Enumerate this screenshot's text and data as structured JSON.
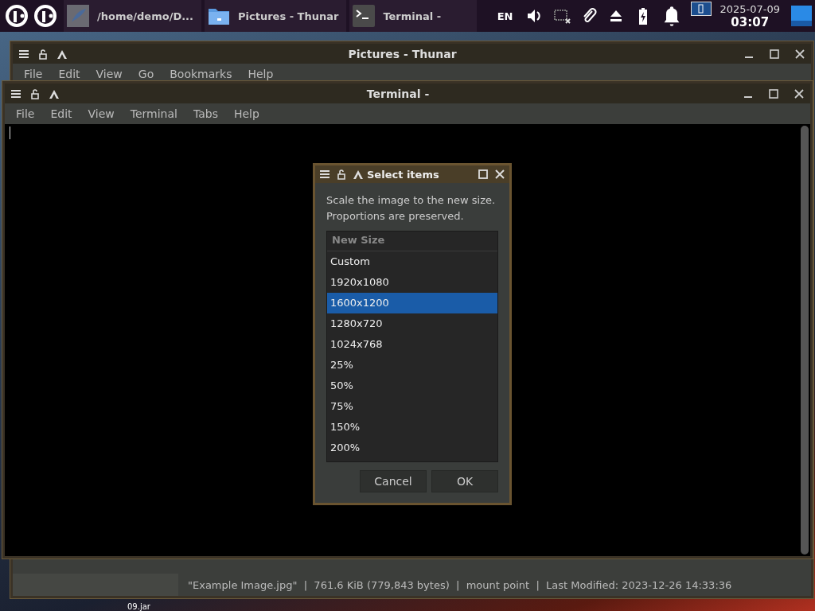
{
  "taskbar": {
    "tasks": [
      {
        "kind": "quill",
        "label": "/home/demo/D...",
        "selected": false
      },
      {
        "kind": "folder",
        "label": "Pictures - Thunar",
        "selected": false
      },
      {
        "kind": "terminal",
        "label": "Terminal -",
        "selected": false
      }
    ],
    "language": "EN",
    "date": "2025-07-09",
    "time": "03:07"
  },
  "desktop_label": "09.jar",
  "thunar": {
    "title": "Pictures - Thunar",
    "menu": [
      "File",
      "Edit",
      "View",
      "Go",
      "Bookmarks",
      "Help"
    ],
    "status": "\"Example Image.jpg\"  |  761.6 KiB (779,843 bytes)  |  mount point  |  Last Modified: 2023-12-26 14:33:36"
  },
  "terminal": {
    "title": "Terminal -",
    "menu": [
      "File",
      "Edit",
      "View",
      "Terminal",
      "Tabs",
      "Help"
    ]
  },
  "dialog": {
    "title": "Select items",
    "message": "Scale the image to the new size.\nProportions are preserved.",
    "column": "New Size",
    "items": [
      {
        "label": "Custom",
        "selected": false
      },
      {
        "label": "1920x1080",
        "selected": false
      },
      {
        "label": "1600x1200",
        "selected": true
      },
      {
        "label": "1280x720",
        "selected": false
      },
      {
        "label": "1024x768",
        "selected": false
      },
      {
        "label": "25%",
        "selected": false
      },
      {
        "label": "50%",
        "selected": false
      },
      {
        "label": "75%",
        "selected": false
      },
      {
        "label": "150%",
        "selected": false
      },
      {
        "label": "200%",
        "selected": false
      }
    ],
    "buttons": [
      "Cancel",
      "OK"
    ]
  }
}
